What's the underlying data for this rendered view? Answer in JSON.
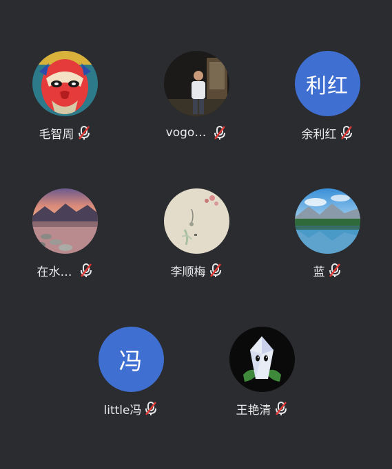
{
  "participants": [
    {
      "name": "毛智周",
      "avatar_type": "image",
      "avatar_icon": "opera-mask-painting",
      "muted": true
    },
    {
      "name": "vogo…",
      "avatar_type": "image",
      "avatar_icon": "man-standing-photo",
      "muted": true
    },
    {
      "name": "余利红",
      "avatar_type": "text",
      "avatar_text": "利红",
      "muted": true
    },
    {
      "name": "在水…",
      "avatar_type": "image",
      "avatar_icon": "lake-sunset-photo",
      "muted": true
    },
    {
      "name": "李顺梅",
      "avatar_type": "image",
      "avatar_icon": "ink-painting-photo",
      "muted": true
    },
    {
      "name": "蓝",
      "avatar_type": "image",
      "avatar_icon": "mountain-lake-photo",
      "muted": true
    },
    {
      "name": "little冯",
      "avatar_type": "text",
      "avatar_text": "冯",
      "muted": true
    },
    {
      "name": "王艳清",
      "avatar_type": "image",
      "avatar_icon": "crystal-character-icon",
      "muted": true
    }
  ],
  "colors": {
    "background": "#2b2c30",
    "text_avatar": "#3f6fd0",
    "mute_slash": "#e53935",
    "name_text": "#e9e9ea"
  },
  "icons": {
    "mute": "mic-muted-icon"
  }
}
